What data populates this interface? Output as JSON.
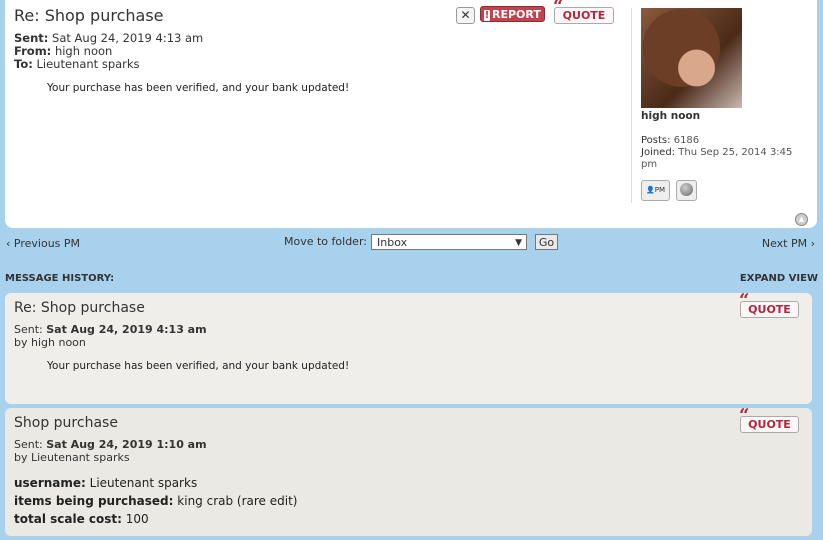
{
  "current_message": {
    "subject": "Re: Shop purchase",
    "sent_label": "Sent:",
    "sent_value": "Sat Aug 24, 2019 4:13 am",
    "from_label": "From:",
    "from_value": "high noon",
    "to_label": "To:",
    "to_value": "Lieutenant sparks",
    "body": "Your purchase has been verified, and your bank updated!",
    "buttons": {
      "report": "REPORT",
      "quote": "QUOTE"
    }
  },
  "author": {
    "name": "high noon",
    "posts_label": "Posts:",
    "posts_value": "6186",
    "joined_label": "Joined:",
    "joined_value": "Thu Sep 25, 2014 3:45 pm",
    "pm_label": "PM"
  },
  "navigation": {
    "previous": "Previous PM",
    "next": "Next PM",
    "move_label": "Move to folder:",
    "folder_selected": "Inbox",
    "go": "Go"
  },
  "history": {
    "label": "MESSAGE HISTORY:",
    "expand": "EXPAND VIEW",
    "messages": [
      {
        "subject": "Re: Shop purchase",
        "sent_label": "Sent:",
        "sent_value": "Sat Aug 24, 2019 4:13 am",
        "by": "by high noon",
        "body": "Your purchase has been verified, and your bank updated!",
        "quote": "QUOTE"
      },
      {
        "subject": "Shop purchase",
        "sent_label": "Sent:",
        "sent_value": "Sat Aug 24, 2019 1:10 am",
        "by": "by Lieutenant sparks",
        "quote": "QUOTE",
        "fields": [
          {
            "label": "username:",
            "value": "Lieutenant sparks"
          },
          {
            "label": "items being purchased:",
            "value": "king crab (rare edit)"
          },
          {
            "label": "total scale cost:",
            "value": "100"
          }
        ]
      }
    ]
  },
  "colors": {
    "page_background": "#a7d1ec",
    "report_button": "#c4424d",
    "quote_text": "#b5243a"
  }
}
